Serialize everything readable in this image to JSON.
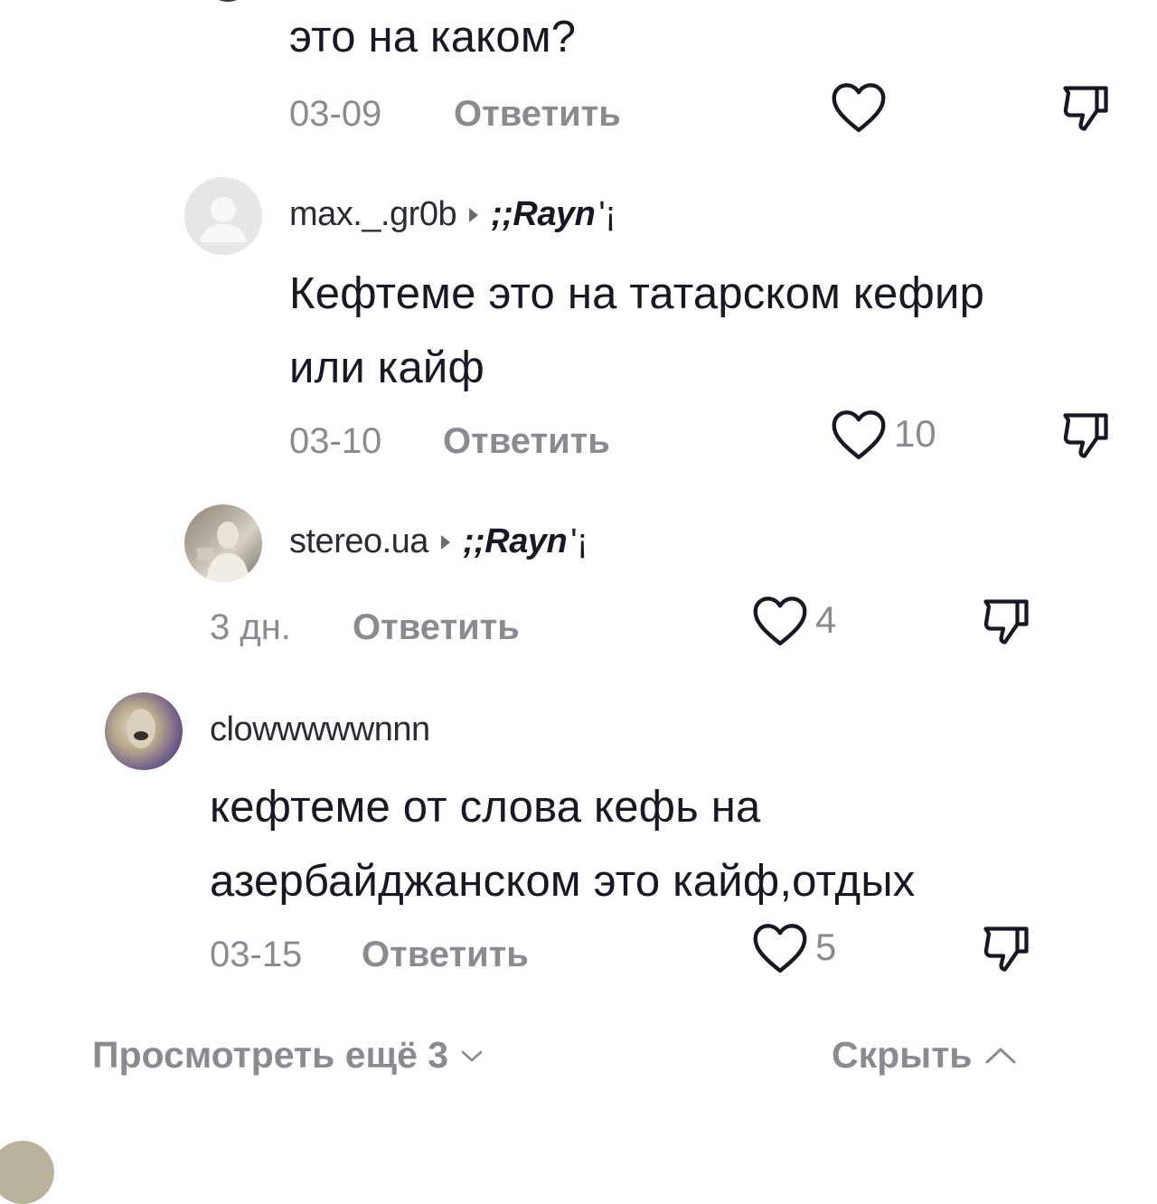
{
  "comments": [
    {
      "text_lines": [
        "это на каком?"
      ],
      "date": "03-09",
      "reply_label": "Ответить",
      "likes": ""
    },
    {
      "username": "max._.gr0b",
      "reply_to": ";;Rayn",
      "reply_to_mark": "'¡",
      "text_lines": [
        "Кефтеме это на татарском кефир",
        "или кайф"
      ],
      "date": "03-10",
      "reply_label": "Ответить",
      "likes": "10"
    },
    {
      "username": "stereo.ua",
      "reply_to": ";;Rayn",
      "reply_to_mark": "'¡",
      "date": "3 дн.",
      "reply_label": "Ответить",
      "likes": "4"
    },
    {
      "username": "clowwwwwnnn",
      "text_lines": [
        "кефтеме от слова кефь на",
        "азербайджанском это кайф,отдых"
      ],
      "date": "03-15",
      "reply_label": "Ответить",
      "likes": "5"
    }
  ],
  "footer": {
    "view_more": "Просмотреть ещё 3",
    "hide": "Скрыть"
  },
  "icons": {
    "like": "heart-outline-icon",
    "dislike": "thumbs-down-icon",
    "expand": "chevron-down-icon",
    "collapse": "chevron-up-icon"
  }
}
